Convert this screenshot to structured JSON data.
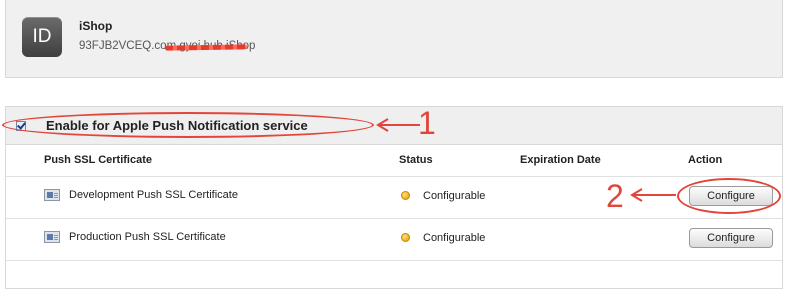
{
  "app": {
    "icon_text": "ID",
    "name": "iShop",
    "bundle_id": "93FJB2VCEQ.com.gyoi.hub.iShop"
  },
  "push": {
    "enable_label": "Enable for Apple Push Notification service",
    "enabled": true,
    "columns": {
      "certificate": "Push SSL Certificate",
      "status": "Status",
      "expiration": "Expiration Date",
      "action": "Action"
    },
    "rows": [
      {
        "certificate": "Development Push SSL Certificate",
        "status": "Configurable",
        "expiration": "",
        "action": "Configure",
        "status_color": "#f0b400"
      },
      {
        "certificate": "Production Push SSL Certificate",
        "status": "Configurable",
        "expiration": "",
        "action": "Configure",
        "status_color": "#f0b400"
      }
    ]
  },
  "annotations": {
    "step_1": "1",
    "step_2": "2",
    "color": "#e2463b"
  }
}
